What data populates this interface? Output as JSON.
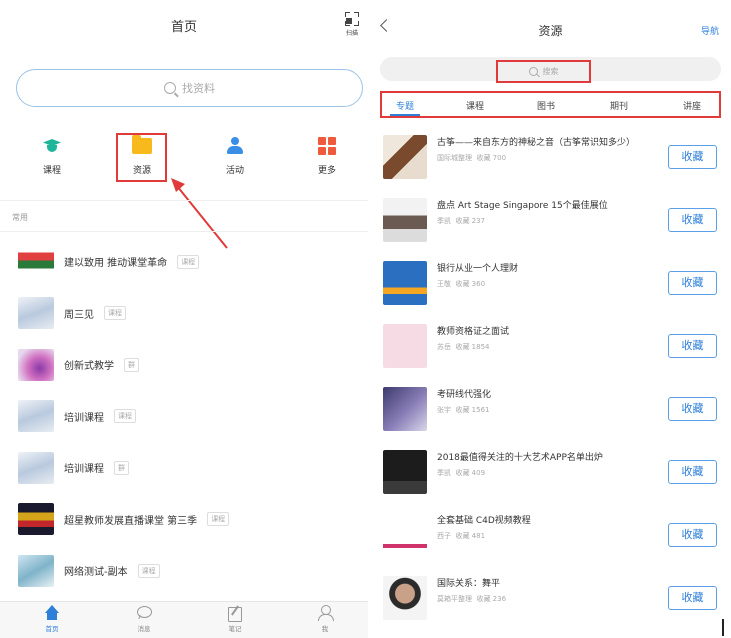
{
  "left": {
    "title": "首页",
    "scan_label": "扫描",
    "search_placeholder": "找资料",
    "grid": [
      {
        "label": "课程",
        "icon": "graduation-cap-icon"
      },
      {
        "label": "资源",
        "icon": "folder-icon"
      },
      {
        "label": "活动",
        "icon": "person-icon"
      },
      {
        "label": "更多",
        "icon": "grid-squares-icon"
      }
    ],
    "section_label": "常用",
    "list": [
      {
        "title": "建以致用 推动课堂革命",
        "tag": "课程"
      },
      {
        "title": "周三见",
        "tag": "课程"
      },
      {
        "title": "创新式教学",
        "tag": "群"
      },
      {
        "title": "培训课程",
        "tag": "课程"
      },
      {
        "title": "培训课程",
        "tag": "群"
      },
      {
        "title": "超星教师发展直播课堂 第三季",
        "tag": "课程"
      },
      {
        "title": "网络测试-副本",
        "tag": "课程"
      }
    ],
    "tabbar": [
      {
        "label": "首页",
        "icon": "home-icon"
      },
      {
        "label": "消息",
        "icon": "message-icon"
      },
      {
        "label": "笔记",
        "icon": "note-icon"
      },
      {
        "label": "我",
        "icon": "user-icon"
      }
    ]
  },
  "right": {
    "title": "资源",
    "nav_link": "导航",
    "search_placeholder": "搜索",
    "tabs": [
      "专题",
      "课程",
      "图书",
      "期刊",
      "讲座"
    ],
    "active_tab": "专题",
    "items": [
      {
        "title": "古筝——来自东方的神秘之音（古筝常识知多少）",
        "author": "国际城整理",
        "favorites": "收藏 700"
      },
      {
        "title": "盘点 Art Stage Singapore 15个最佳展位",
        "author": "季凯",
        "favorites": "收藏 237"
      },
      {
        "title": "银行从业一个人理财",
        "author": "王敬",
        "favorites": "收藏 360"
      },
      {
        "title": "教师资格证之面试",
        "author": "苏岳",
        "favorites": "收藏 1854"
      },
      {
        "title": "考研线代强化",
        "author": "张宇",
        "favorites": "收藏 1561"
      },
      {
        "title": "2018最值得关注的十大艺术APP名单出炉",
        "author": "季凯",
        "favorites": "收藏 409"
      },
      {
        "title": "全套基础 C4D视频教程",
        "author": "西子",
        "favorites": "收藏 481"
      },
      {
        "title": "国际关系：舞平",
        "author": "莫箱平整理",
        "favorites": "收藏 236"
      }
    ],
    "fav_button": "收藏"
  },
  "colors": {
    "accent": "#2e7fd8",
    "highlight": "#e03a3a",
    "course_icon": "#1fb59a",
    "folder_icon": "#f7b91c",
    "activity_icon": "#3a8ee6",
    "more_icon": "#f05a3c"
  }
}
